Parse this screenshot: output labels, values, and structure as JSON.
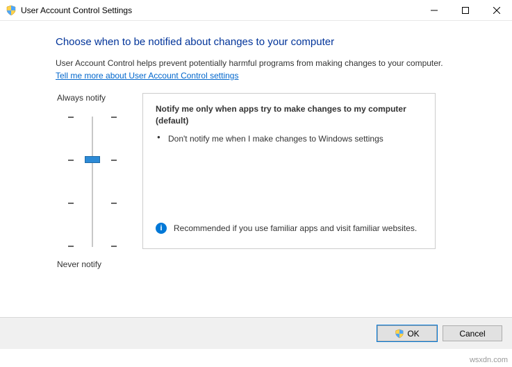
{
  "window": {
    "title": "User Account Control Settings"
  },
  "main": {
    "heading": "Choose when to be notified about changes to your computer",
    "description": "User Account Control helps prevent potentially harmful programs from making changes to your computer.",
    "help_link": "Tell me more about User Account Control settings"
  },
  "slider": {
    "top_label": "Always notify",
    "bottom_label": "Never notify",
    "level": 2,
    "levels_total": 4
  },
  "info": {
    "title": "Notify me only when apps try to make changes to my computer (default)",
    "bullet": "Don't notify me when I make changes to Windows settings",
    "recommend": "Recommended if you use familiar apps and visit familiar websites."
  },
  "buttons": {
    "ok": "OK",
    "cancel": "Cancel"
  },
  "watermark": "wsxdn.com"
}
